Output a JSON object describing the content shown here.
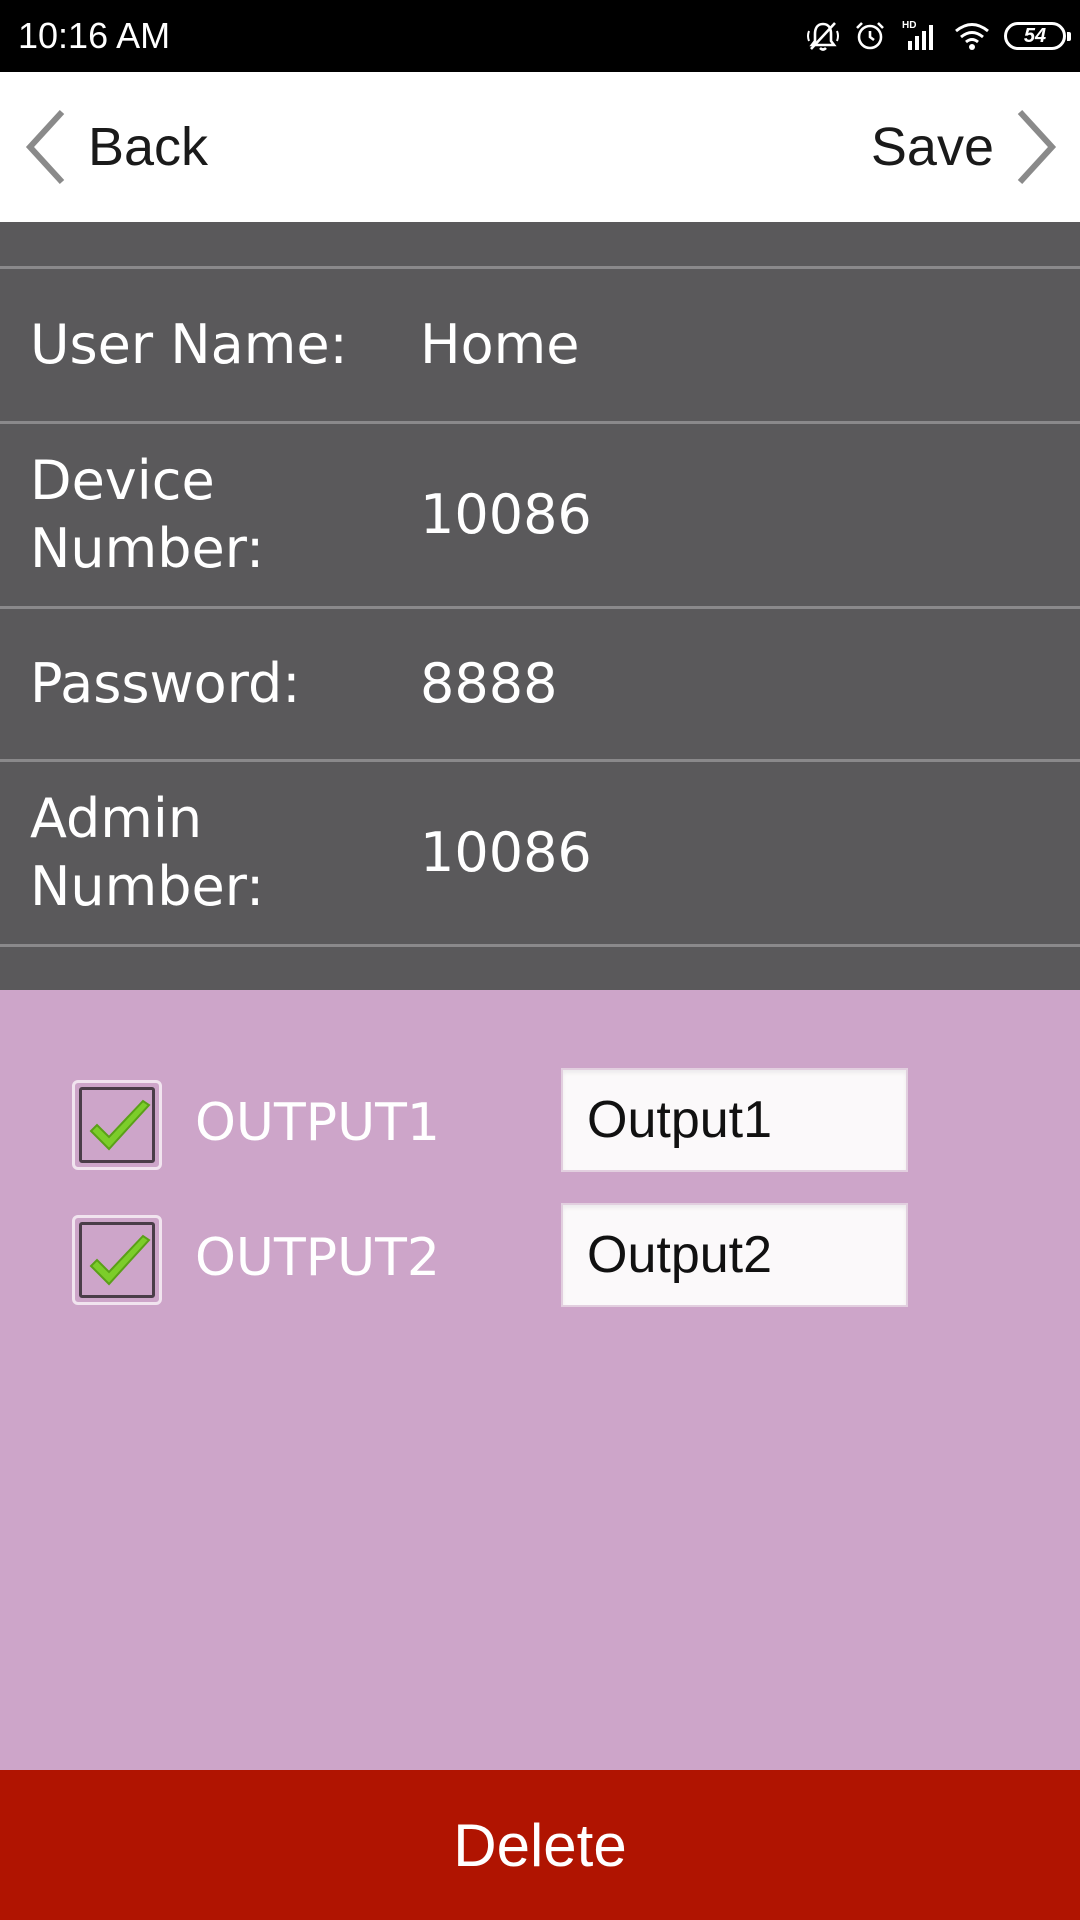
{
  "status_bar": {
    "time": "10:16  AM",
    "battery": "54",
    "icons": [
      "mute-vibrate-icon",
      "alarm-icon",
      "hd-signal-icon",
      "wifi-icon",
      "battery-icon"
    ]
  },
  "header": {
    "back_label": "Back",
    "save_label": "Save"
  },
  "form": {
    "rows": [
      {
        "label": "User Name:",
        "value": "Home"
      },
      {
        "label": "Device Number:",
        "value": "10086"
      },
      {
        "label": "Password:",
        "value": "8888"
      },
      {
        "label": "Admin Number:",
        "value": "10086"
      }
    ]
  },
  "outputs": [
    {
      "label": "OUTPUT1",
      "checked": true,
      "name_value": "Output1"
    },
    {
      "label": "OUTPUT2",
      "checked": true,
      "name_value": "Output2"
    }
  ],
  "delete_label": "Delete",
  "colors": {
    "status_bar": "#000000",
    "header": "#ffffff",
    "form_bg": "#5a595b",
    "outputs_bg": "#cda5c9",
    "delete_bg": "#b01401",
    "check_green": "#7ccd2a"
  }
}
